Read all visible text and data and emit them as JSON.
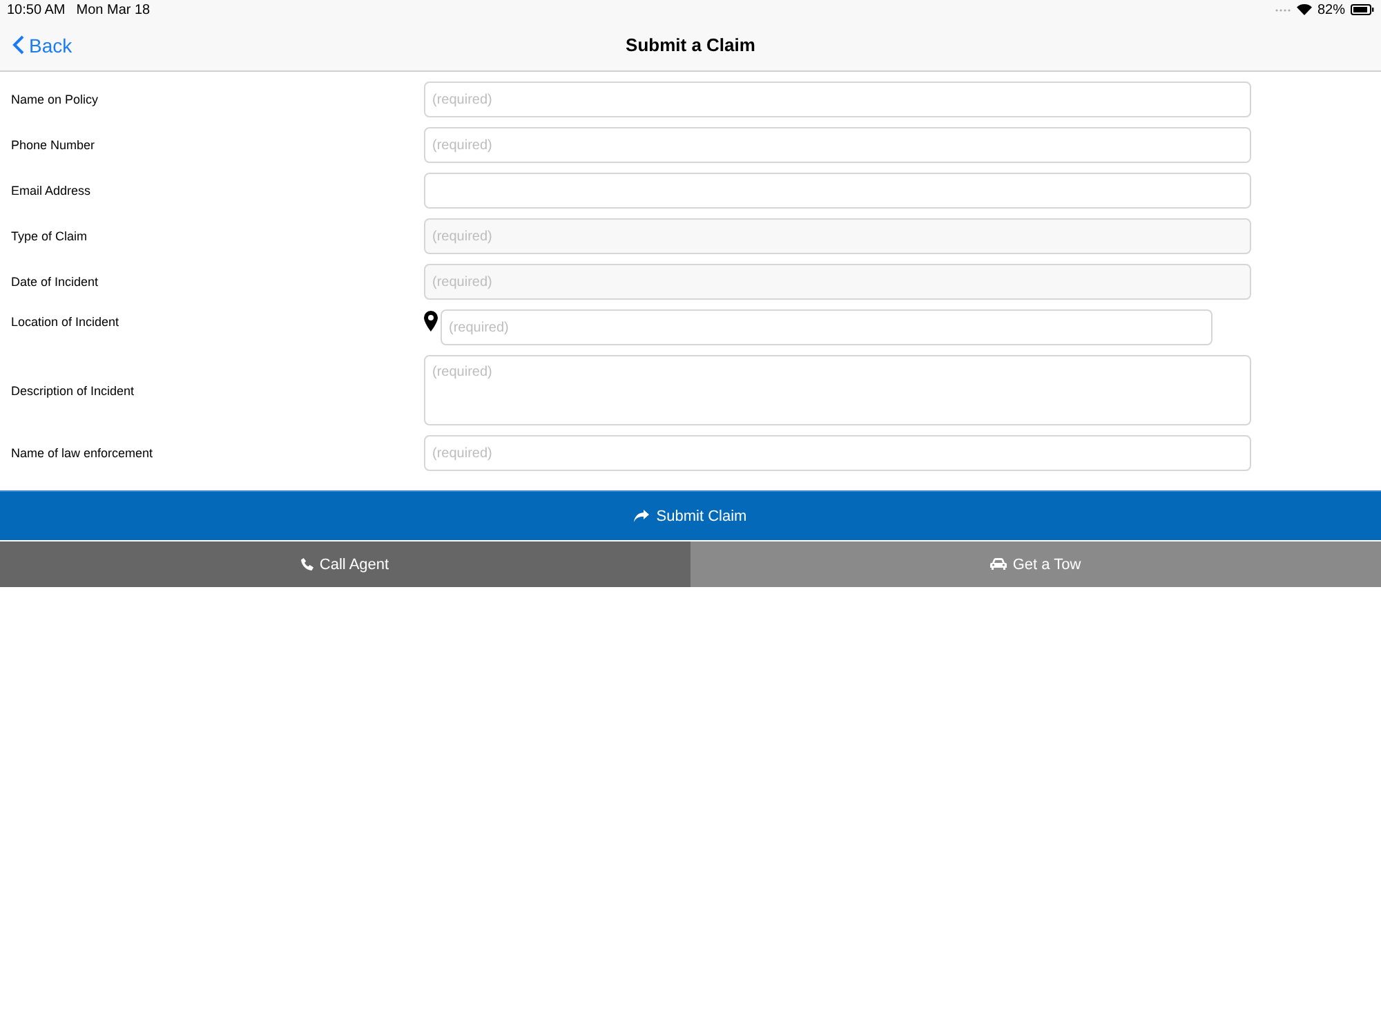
{
  "status_bar": {
    "time": "10:50 AM",
    "date": "Mon Mar 18",
    "battery": "82%"
  },
  "nav": {
    "back": "Back",
    "title": "Submit a Claim"
  },
  "fields": [
    {
      "label": "Name on Policy",
      "kind": "text",
      "placeholder": "(required)"
    },
    {
      "label": "Phone Number",
      "kind": "text",
      "placeholder": "(required)"
    },
    {
      "label": "Email Address",
      "kind": "text"
    },
    {
      "label": "Type of Claim",
      "kind": "picker",
      "placeholder": "(required)"
    },
    {
      "label": "Date of Incident",
      "kind": "picker",
      "placeholder": "(required)"
    },
    {
      "label": "Location of Incident",
      "kind": "location",
      "placeholder": "(required)"
    },
    {
      "label": "Description of Incident",
      "kind": "textarea",
      "placeholder": "(required)"
    },
    {
      "label": "Name of law enforcement",
      "kind": "text",
      "placeholder": "(required)"
    }
  ],
  "submit": "Submit Claim",
  "actions": [
    {
      "label": "Call Agent",
      "kind": "call"
    },
    {
      "label": "Get a Tow",
      "kind": "tow"
    }
  ]
}
